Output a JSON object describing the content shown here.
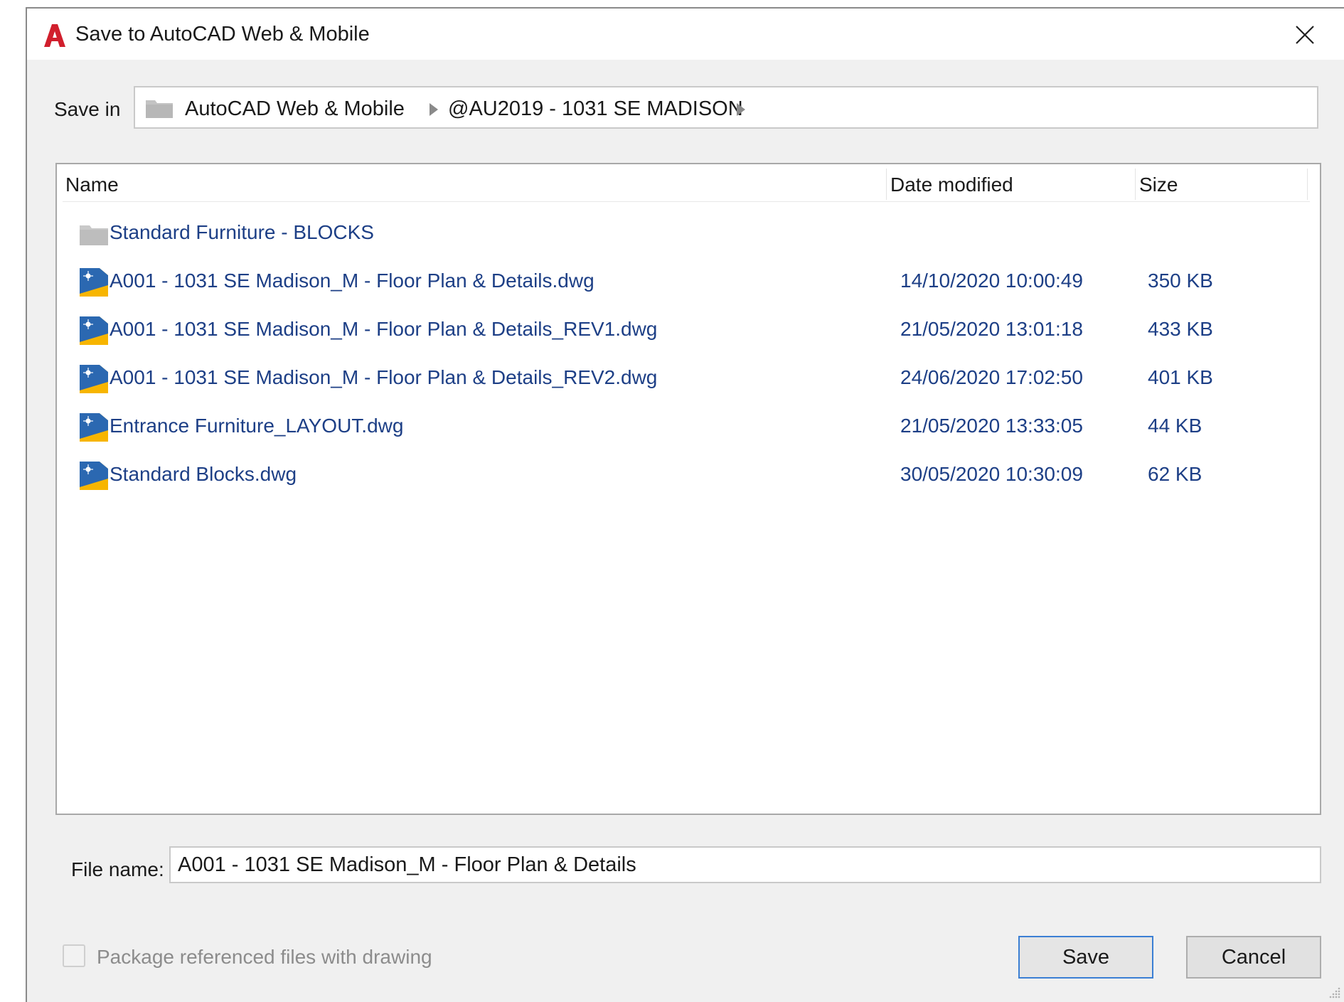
{
  "window": {
    "title": "Save to AutoCAD Web & Mobile",
    "app_icon": "autocad-a-icon",
    "close_icon": "close-icon"
  },
  "save_in": {
    "label": "Save in",
    "folder_icon": "folder-icon",
    "breadcrumbs": [
      "AutoCAD Web & Mobile",
      "@AU2019 - 1031 SE MADISON"
    ]
  },
  "file_list": {
    "columns": {
      "name": "Name",
      "date": "Date modified",
      "size": "Size"
    },
    "rows": [
      {
        "icon": "folder-icon",
        "name": "Standard Furniture - BLOCKS",
        "date": "",
        "size": ""
      },
      {
        "icon": "dwg-file-icon",
        "name": "A001 - 1031 SE Madison_M - Floor Plan & Details.dwg",
        "date": "14/10/2020 10:00:49",
        "size": "350 KB"
      },
      {
        "icon": "dwg-file-icon",
        "name": "A001 - 1031 SE Madison_M - Floor Plan & Details_REV1.dwg",
        "date": "21/05/2020 13:01:18",
        "size": "433 KB"
      },
      {
        "icon": "dwg-file-icon",
        "name": "A001 - 1031 SE Madison_M - Floor Plan & Details_REV2.dwg",
        "date": "24/06/2020 17:02:50",
        "size": "401 KB"
      },
      {
        "icon": "dwg-file-icon",
        "name": "Entrance Furniture_LAYOUT.dwg",
        "date": "21/05/2020 13:33:05",
        "size": "44 KB"
      },
      {
        "icon": "dwg-file-icon",
        "name": "Standard Blocks.dwg",
        "date": "30/05/2020 10:30:09",
        "size": "62 KB"
      }
    ]
  },
  "file_name": {
    "label": "File name:",
    "value": "A001 - 1031 SE Madison_M - Floor Plan & Details"
  },
  "package": {
    "label": "Package referenced files with drawing",
    "checked": false,
    "enabled": false
  },
  "buttons": {
    "save": "Save",
    "cancel": "Cancel"
  },
  "colors": {
    "dialog_bg": "#f0f0f0",
    "link_text": "#1d3f86",
    "autocad_red": "#d11f2d",
    "default_button_border": "#3b7fd4"
  }
}
